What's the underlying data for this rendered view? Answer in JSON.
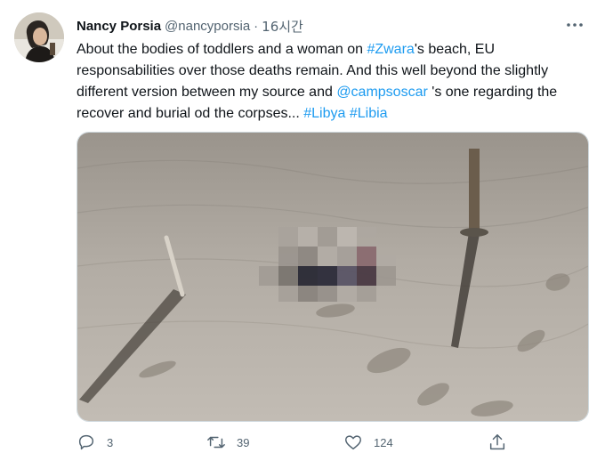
{
  "author": {
    "name": "Nancy Porsia",
    "handle": "@nancyporsia",
    "separator": "·",
    "time": "16시간"
  },
  "tweet": {
    "segments": [
      {
        "text": "About the bodies of toddlers and a woman on ",
        "link": false
      },
      {
        "text": "#Zwara",
        "link": true
      },
      {
        "text": "'s beach, EU responsabilities over those deaths remain. And this well beyond the slightly different version between my source and ",
        "link": false
      },
      {
        "text": "@campsoscar",
        "link": true
      },
      {
        "text": " 's one regarding the recover and burial od the corpses... ",
        "link": false
      },
      {
        "text": "#Libya",
        "link": true
      },
      {
        "text": " ",
        "link": false
      },
      {
        "text": "#Libia",
        "link": true
      }
    ]
  },
  "actions": {
    "reply_count": "3",
    "retweet_count": "39",
    "like_count": "124"
  },
  "colors": {
    "link": "#1d9bf0",
    "muted": "#536471"
  },
  "icons": {
    "more": "more-horizontal-icon",
    "reply": "reply-icon",
    "retweet": "retweet-icon",
    "like": "heart-icon",
    "share": "share-icon"
  }
}
